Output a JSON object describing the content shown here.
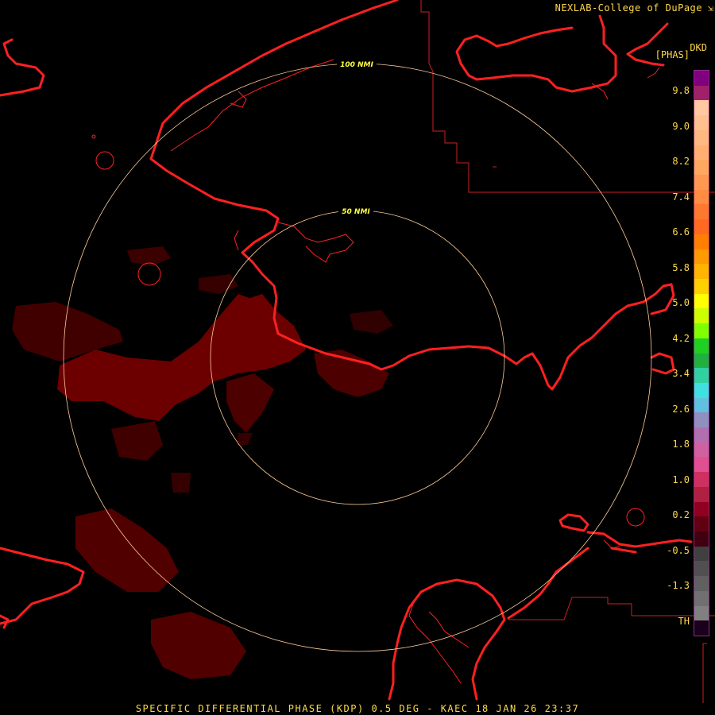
{
  "credit": "NEXLAB-College of DuPage",
  "credit_mark": "⇲",
  "product_code": "DKD",
  "units": "[PHAS]",
  "footer": "SPECIFIC DIFFERENTIAL PHASE (KDP) 0.5 DEG - KAEC 18 JAN 26 23:37",
  "rings": [
    {
      "label": "100 NMI",
      "radius_nmi": 100
    },
    {
      "label": "50 NMI",
      "radius_nmi": 50
    }
  ],
  "colorbar_labels": [
    "9.8",
    "9.0",
    "8.2",
    "7.4",
    "6.6",
    "5.8",
    "5.0",
    "4.2",
    "3.4",
    "2.6",
    "1.8",
    "1.0",
    "0.2",
    "-0.5",
    "-1.3",
    "TH"
  ],
  "colorbar_colors": [
    "#800080",
    "#a0206a",
    "#ffc8a0",
    "#ffc090",
    "#ffb880",
    "#ffb070",
    "#ffa860",
    "#ff9850",
    "#ff8c40",
    "#ff7830",
    "#ff6a20",
    "#ff8000",
    "#ff9a00",
    "#ffb400",
    "#ffd000",
    "#ffff00",
    "#ccff00",
    "#80ff00",
    "#20d020",
    "#20b040",
    "#30d0a0",
    "#40e0e0",
    "#60c0e0",
    "#9090c0",
    "#b070b0",
    "#d060a0",
    "#e05090",
    "#d03060",
    "#b02040",
    "#900020",
    "#600010",
    "#400010",
    "#404040",
    "#505050",
    "#606060",
    "#707070",
    "#808080",
    "#1a001a"
  ],
  "map_colors": {
    "coastline": "#ff2020",
    "county": "#cc2020",
    "ring": "#ffcc99",
    "echo": "#800000",
    "background": "#000000"
  }
}
